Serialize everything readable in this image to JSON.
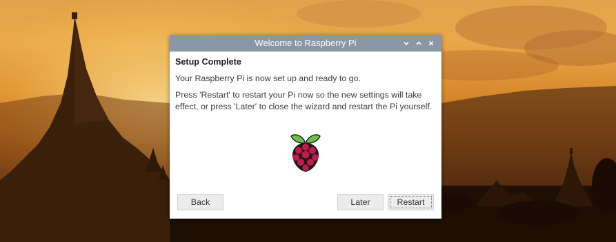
{
  "window": {
    "title": "Welcome to Raspberry Pi",
    "controls": {
      "minimize_icon": "chevron-down-icon",
      "maximize_icon": "chevron-up-icon",
      "close_icon": "close-icon"
    }
  },
  "wizard": {
    "heading": "Setup Complete",
    "line1": "Your Raspberry Pi is now set up and ready to go.",
    "line2": "Press 'Restart' to restart your Pi now so the new settings will take effect, or press 'Later' to close the wizard and restart the Pi yourself.",
    "logo": "raspberry-pi-logo"
  },
  "buttons": {
    "back": "Back",
    "later": "Later",
    "restart": "Restart"
  },
  "colors": {
    "titlebar": "#8a97a6",
    "window_bg": "#ffffff",
    "button_bg": "#ececec",
    "logo_red": "#c51a4a",
    "logo_green": "#6cc04a"
  }
}
